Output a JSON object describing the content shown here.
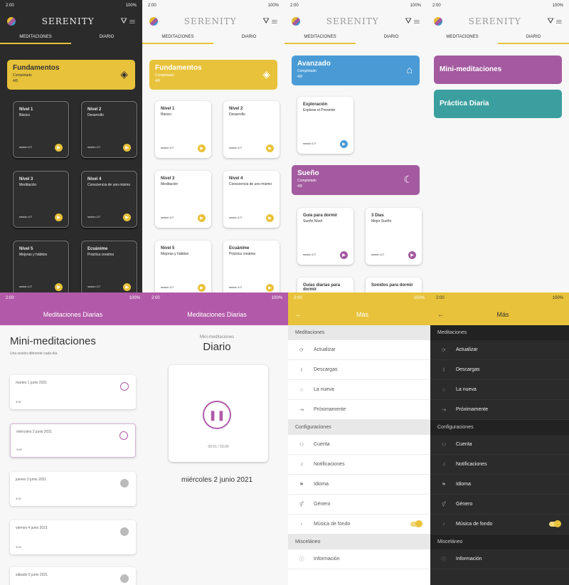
{
  "app": {
    "brand": "SERENITY",
    "status_left": "2:00",
    "status_right": "100%",
    "tabs": [
      "MEDITACIONES",
      "DIARIO"
    ],
    "filter_icon": "filter-icon",
    "menu_icon": "menu-icon"
  },
  "fundamentos": {
    "title": "Fundamentos",
    "subtitle": "Completado",
    "count": "4/8",
    "cards": [
      {
        "h": "Nivel 1",
        "d": "Básico",
        "meta": "sesión 1/7"
      },
      {
        "h": "Nivel 2",
        "d": "Desarrollo",
        "meta": "sesión 1/7"
      },
      {
        "h": "Nivel 3",
        "d": "Meditación",
        "meta": "sesión 1/7"
      },
      {
        "h": "Nivel 4",
        "d": "Consciencia de uno mismo",
        "meta": "sesión 1/7"
      },
      {
        "h": "Nivel 5",
        "d": "Mejoras y hábitos",
        "meta": "sesión 1/7"
      },
      {
        "h": "Ecuánime",
        "d": "Práctica creativa",
        "meta": "sesión 1/7"
      }
    ]
  },
  "avanzado": {
    "title": "Avanzado",
    "subtitle": "Completado",
    "count": "4/8",
    "card": {
      "h": "Exploración",
      "d": "Explorar el Presente",
      "meta": "sesión 1/7"
    }
  },
  "sueno": {
    "title": "Sueño",
    "subtitle": "Completado",
    "count": "4/8",
    "cards": [
      {
        "h": "Guía para dormir",
        "d": "Sueño Nivel",
        "meta": "sesión 1/7"
      },
      {
        "h": "3 Días",
        "d": "Mejor Sueño",
        "meta": "sesión 1/7"
      },
      {
        "h": "Guías diarias para dormir",
        "d": "",
        "meta": ""
      },
      {
        "h": "Sonidos para dormir",
        "d": "",
        "meta": ""
      }
    ]
  },
  "diario_tab": {
    "items": [
      "Mini-meditaciones",
      "Práctica Diaria"
    ]
  },
  "mini": {
    "bar_title": "Meditaciones Diarias",
    "title": "Mini-meditaciones",
    "subtitle": "Una sesión diferente cada día",
    "days": [
      {
        "date": "martes 1 junio 2021",
        "dur": "3:00"
      },
      {
        "date": "miércoles 2 junio 2021",
        "dur": "3:00"
      },
      {
        "date": "jueves 3 junio 2021",
        "dur": "3:00"
      },
      {
        "date": "viernes 4 junio 2021",
        "dur": "3:00"
      },
      {
        "date": "sábado 5 junio 2021",
        "dur": "3:00"
      }
    ]
  },
  "player": {
    "bar_title": "Meditaciones Diarias",
    "kicker": "Mini-meditaciones",
    "title": "Diario",
    "time": "00:01 / 03:00",
    "date": "miércoles 2 junio 2021"
  },
  "more": {
    "title": "Más",
    "sections": [
      {
        "name": "Meditaciones",
        "items": [
          {
            "label": "Actualizar",
            "icon": "refresh-icon",
            "glyph": "⟳"
          },
          {
            "label": "Descargas",
            "icon": "download-icon",
            "glyph": "⇩"
          },
          {
            "label": "La nueva",
            "icon": "star-icon",
            "glyph": "☆"
          },
          {
            "label": "Próximamente",
            "icon": "login-icon",
            "glyph": "⇥"
          }
        ]
      },
      {
        "name": "Configuraciones",
        "items": [
          {
            "label": "Cuenta",
            "icon": "account-icon",
            "glyph": "⚇"
          },
          {
            "label": "Notificaciones",
            "icon": "bell-icon",
            "glyph": "♫"
          },
          {
            "label": "Idioma",
            "icon": "flag-icon",
            "glyph": "⚑"
          },
          {
            "label": "Género",
            "icon": "gender-icon",
            "glyph": "⚥"
          },
          {
            "label": "Música de fondo",
            "icon": "music-icon",
            "glyph": "♪",
            "toggle": true
          }
        ]
      },
      {
        "name": "Misceláneo",
        "items": [
          {
            "label": "Información",
            "icon": "info-icon",
            "glyph": "ⓘ"
          }
        ]
      }
    ]
  },
  "colors": {
    "yellow": "#e8c23a",
    "blue": "#4a9bd5",
    "purple": "#a35a9f",
    "teal": "#3c9f9f",
    "pink": "#b25aa9"
  }
}
